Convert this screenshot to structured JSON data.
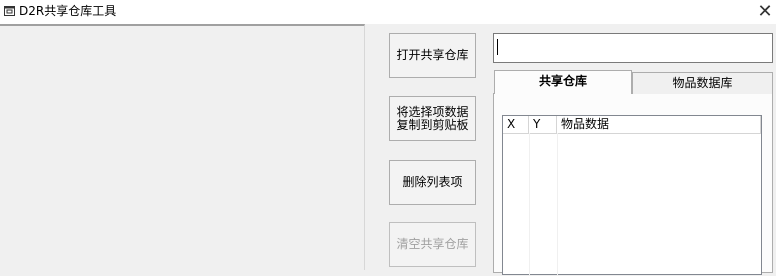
{
  "window": {
    "title": "D2R共享仓库工具",
    "close_glyph": "✕"
  },
  "buttons": {
    "open_shared_stash": "打开共享仓库",
    "copy_selected": "将选择项数据\n复制到剪贴板",
    "delete_list_item": "删除列表项",
    "clear_shared_stash": "清空共享仓库"
  },
  "path_input": {
    "value": ""
  },
  "tabs": [
    {
      "label": "共享仓库",
      "active": true
    },
    {
      "label": "物品数据库",
      "active": false
    }
  ],
  "list": {
    "columns": [
      "X",
      "Y",
      "物品数据"
    ],
    "rows": []
  }
}
